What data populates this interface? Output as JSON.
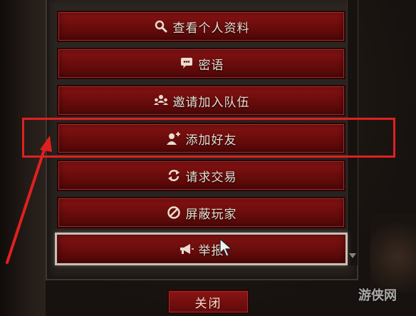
{
  "menu": {
    "items": [
      {
        "label": "查看个人资料",
        "icon": "magnifier-icon"
      },
      {
        "label": "密语",
        "icon": "speech-bubble-icon"
      },
      {
        "label": "邀请加入队伍",
        "icon": "group-icon"
      },
      {
        "label": "添加好友",
        "icon": "add-user-icon"
      },
      {
        "label": "请求交易",
        "icon": "exchange-icon"
      },
      {
        "label": "屏蔽玩家",
        "icon": "block-icon"
      },
      {
        "label": "举报",
        "icon": "megaphone-icon"
      }
    ],
    "close_label": "关闭"
  },
  "watermark": {
    "text": "游侠网"
  },
  "colors": {
    "button_red": "#7a1010",
    "highlight_red": "#e02020",
    "text": "#e8ddd0"
  }
}
